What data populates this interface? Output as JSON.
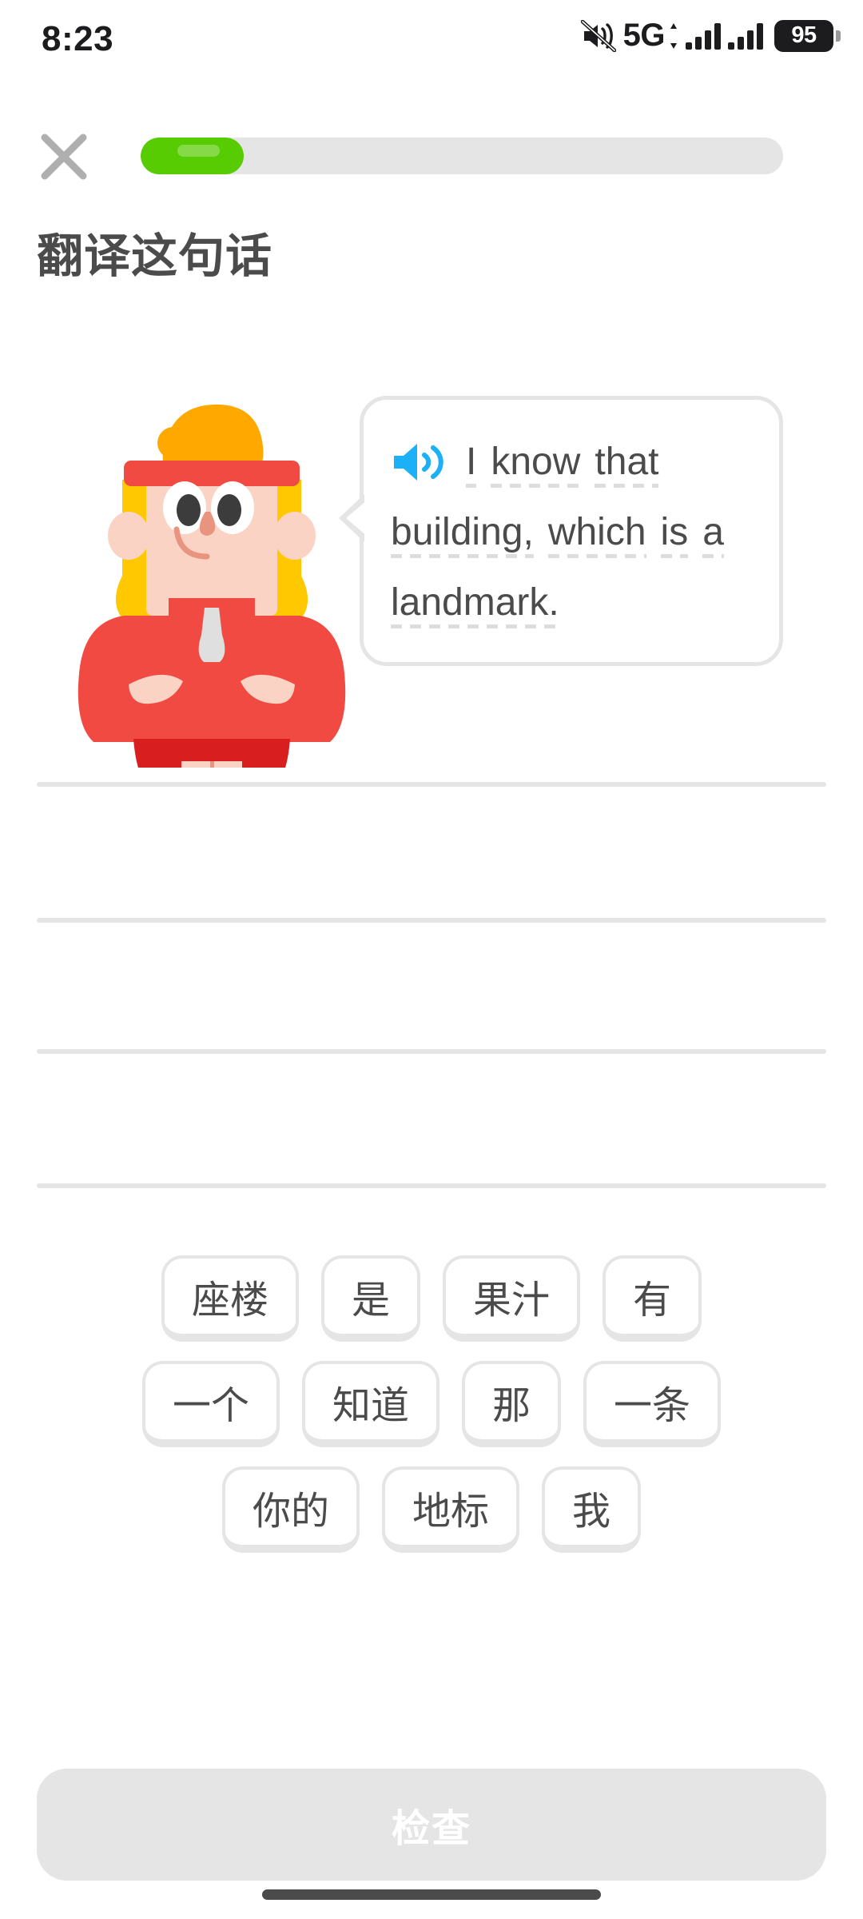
{
  "status_bar": {
    "time": "8:23",
    "network_label": "5G",
    "battery_percent": "95",
    "icons": [
      "mute-icon",
      "cellular-signal-icon",
      "cellular-signal-icon",
      "battery-icon"
    ]
  },
  "header": {
    "close_icon": "close-icon",
    "progress_percent": 16
  },
  "exercise": {
    "title": "翻译这句话",
    "speaker_icon": "speaker-icon",
    "prompt_sentence": "I know that building, which is a landmark.",
    "prompt_words": [
      {
        "text": "I",
        "dashed": true
      },
      {
        "text": "know",
        "dashed": true
      },
      {
        "text": "that",
        "dashed": true
      },
      {
        "text": "building,",
        "dashed": true
      },
      {
        "text": "which",
        "dashed": true
      },
      {
        "text": "is",
        "dashed": true
      },
      {
        "text": "a",
        "dashed": true
      },
      {
        "text": "landmark.",
        "dashed": true
      }
    ],
    "character": "mascot-eddy"
  },
  "answer_lines": 4,
  "word_bank": {
    "rows": [
      [
        "座楼",
        "是",
        "果汁",
        "有"
      ],
      [
        "一个",
        "知道",
        "那",
        "一条"
      ],
      [
        "你的",
        "地标",
        "我"
      ]
    ]
  },
  "footer": {
    "check_label": "检查",
    "check_enabled": false
  },
  "colors": {
    "duo_green": "#58CC02",
    "duo_blue": "#1CB0F6",
    "text_gray": "#4B4B4B",
    "border_gray": "#E5E5E5",
    "mascot_red": "#F14A42",
    "mascot_red_dark": "#D81E1E",
    "mascot_hair": "#FFC800",
    "mascot_skin": "#FBD3C5"
  }
}
